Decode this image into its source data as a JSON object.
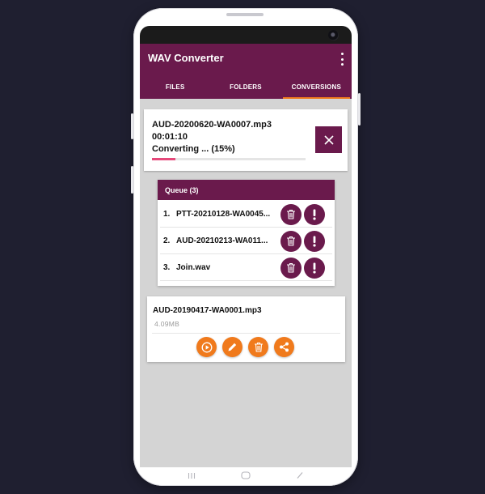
{
  "app": {
    "title": "WAV Converter"
  },
  "tabs": [
    {
      "label": "FILES",
      "active": false
    },
    {
      "label": "FOLDERS",
      "active": false
    },
    {
      "label": "CONVERSIONS",
      "active": true
    }
  ],
  "conversion": {
    "file_name": "AUD-20200620-WA0007.mp3",
    "duration": "00:01:10",
    "status": "Converting ... (15%)",
    "progress_fraction": 0.15
  },
  "queue": {
    "title": "Queue (3)",
    "items": [
      {
        "index": "1.",
        "name": "PTT-20210128-WA0045..."
      },
      {
        "index": "2.",
        "name": "AUD-20210213-WA011..."
      },
      {
        "index": "3.",
        "name": "Join.wav"
      }
    ]
  },
  "file": {
    "name": "AUD-20190417-WA0001.mp3",
    "size": "4.09MB"
  },
  "icons": {
    "cancel": "close-icon",
    "queue_delete": "trash-icon",
    "queue_info": "exclamation-icon",
    "file_actions": [
      "play-icon",
      "edit-icon",
      "trash-icon",
      "share-icon"
    ]
  },
  "colors": {
    "primary": "#6a1a4c",
    "accent": "#f07a1c",
    "progress": "#e5487a",
    "background": "#1f1f30"
  }
}
